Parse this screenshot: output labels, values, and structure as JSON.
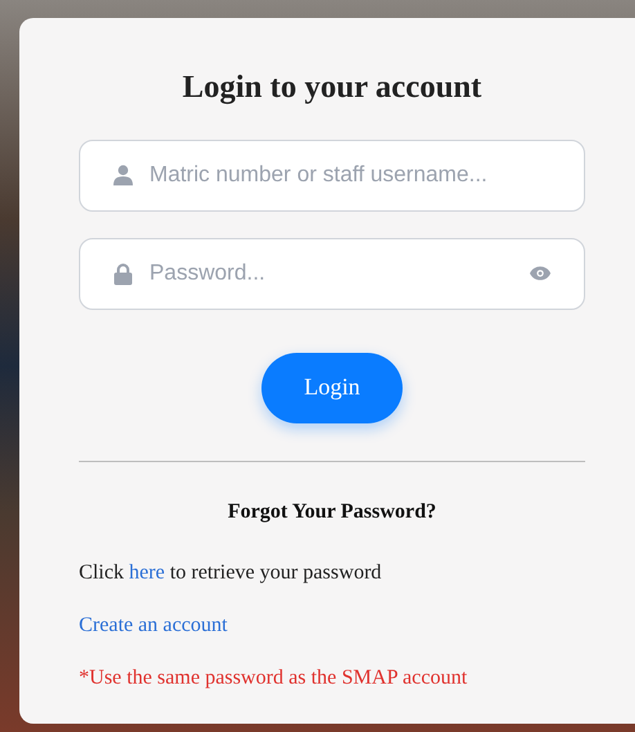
{
  "title": "Login to your account",
  "fields": [
    {
      "kind": "user",
      "placeholder": "Matric number or staff username..."
    },
    {
      "kind": "password",
      "placeholder": "Password..."
    }
  ],
  "login_button": "Login",
  "forgot_heading": "Forgot Your Password?",
  "retrieve": {
    "before": "Click",
    "link": "here",
    "after": "to retrieve your password"
  },
  "create_link": "Create an account",
  "note": "*Use the same password as the SMAP account"
}
